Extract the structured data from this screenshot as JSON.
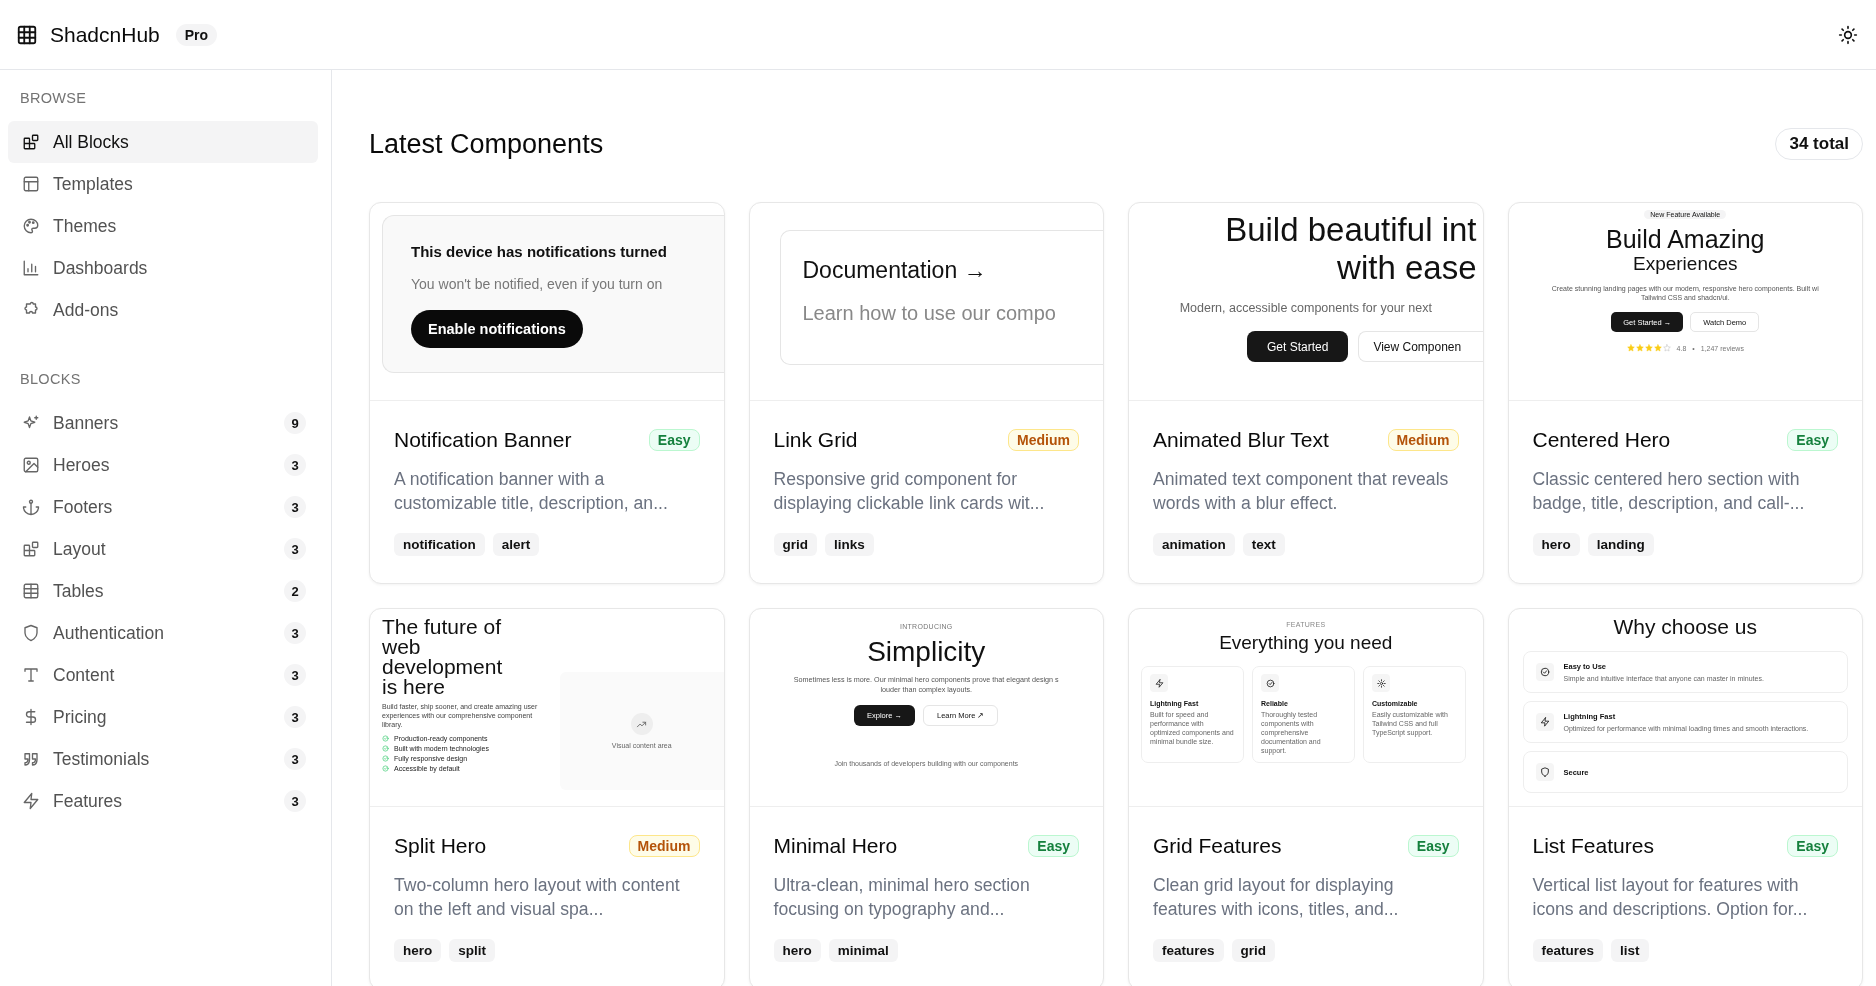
{
  "header": {
    "title": "ShadcnHub",
    "badge": "Pro"
  },
  "sidebar": {
    "sections": [
      {
        "heading": "BROWSE",
        "items": [
          {
            "label": "All Blocks",
            "selected": true
          },
          {
            "label": "Templates",
            "selected": false
          },
          {
            "label": "Themes",
            "selected": false
          },
          {
            "label": "Dashboards",
            "selected": false
          },
          {
            "label": "Add-ons",
            "selected": false
          }
        ]
      },
      {
        "heading": "BLOCKS",
        "items": [
          {
            "label": "Banners",
            "count": "9",
            "selected": false
          },
          {
            "label": "Heroes",
            "count": "3",
            "selected": false
          },
          {
            "label": "Footers",
            "count": "3",
            "selected": false
          },
          {
            "label": "Layout",
            "count": "3",
            "selected": false
          },
          {
            "label": "Tables",
            "count": "2",
            "selected": false
          },
          {
            "label": "Authentication",
            "count": "3",
            "selected": false
          },
          {
            "label": "Content",
            "count": "3",
            "selected": false
          },
          {
            "label": "Pricing",
            "count": "3",
            "selected": false
          },
          {
            "label": "Testimonials",
            "count": "3",
            "selected": false
          },
          {
            "label": "Features",
            "count": "3",
            "selected": false
          }
        ]
      }
    ]
  },
  "main": {
    "title": "Latest Components",
    "total": "34 total",
    "cards": [
      {
        "preview": {
          "kind": "notification",
          "title": "This device has notifications turned",
          "text": "You won't be notified, even if you turn on",
          "button": "Enable notifications"
        },
        "title": "Notification Banner",
        "difficulty": {
          "label": "Easy",
          "kind": "easy"
        },
        "description": "A notification banner with a customizable title, description, an...",
        "tags": [
          "notification",
          "alert"
        ]
      },
      {
        "preview": {
          "kind": "link",
          "title": "Documentation →",
          "text": "Learn how to use our compo"
        },
        "title": "Link Grid",
        "difficulty": {
          "label": "Medium",
          "kind": "medium"
        },
        "description": "Responsive grid component for displaying clickable link cards wit...",
        "tags": [
          "grid",
          "links"
        ]
      },
      {
        "preview": {
          "kind": "blur-text",
          "heading": "Build beautiful int\nwith ease",
          "text": "Modern, accessible components for your next",
          "buttons": [
            "Get Started",
            "View Componen"
          ]
        },
        "title": "Animated Blur Text",
        "difficulty": {
          "label": "Medium",
          "kind": "medium"
        },
        "description": "Animated text component that reveals words with a blur effect.",
        "tags": [
          "animation",
          "text"
        ]
      },
      {
        "preview": {
          "kind": "centered-hero",
          "badge": "New Feature Available",
          "title": "Build Amazing",
          "subtitle": "Experiences",
          "text": "Create stunning landing pages with our modern, responsive hero components. Built wi\nTailwind CSS and shadcn/ui.",
          "buttons": [
            "Get Started →",
            "Watch Demo"
          ],
          "stars": 4,
          "rating": "4.8",
          "separator": "•",
          "reviews": "1,247 reviews"
        },
        "title": "Centered Hero",
        "difficulty": {
          "label": "Easy",
          "kind": "easy"
        },
        "description": "Classic centered hero section with badge, title, description, and call-...",
        "tags": [
          "hero",
          "landing"
        ]
      },
      {
        "preview": {
          "kind": "split-hero",
          "heading": "The future of web development is here",
          "text": "Build faster, ship sooner, and create amazing user experiences with our comprehensive component library.",
          "checklist": [
            "Production-ready components",
            "Built with modern technologies",
            "Fully responsive design",
            "Accessible by default"
          ],
          "visual_label": "Visual content area"
        },
        "title": "Split Hero",
        "difficulty": {
          "label": "Medium",
          "kind": "medium"
        },
        "description": "Two-column hero layout with content on the left and visual spa...",
        "tags": [
          "hero",
          "split"
        ]
      },
      {
        "preview": {
          "kind": "minimal-hero",
          "eyebrow": "INTRODUCING",
          "heading": "Simplicity",
          "text": "Sometimes less is more. Our minimal hero components prove that elegant design s\nlouder than complex layouts.",
          "buttons": [
            "Explore →",
            "Learn More ↗"
          ],
          "footnote": "Join thousands of developers building with our components"
        },
        "title": "Minimal Hero",
        "difficulty": {
          "label": "Easy",
          "kind": "easy"
        },
        "description": "Ultra-clean, minimal hero section focusing on typography and...",
        "tags": [
          "hero",
          "minimal"
        ]
      },
      {
        "preview": {
          "kind": "grid-features",
          "eyebrow": "FEATURES",
          "heading": "Everything you need",
          "features": [
            {
              "title": "Lightning Fast",
              "text": "Built for speed and performance with optimized components and minimal bundle size."
            },
            {
              "title": "Reliable",
              "text": "Thoroughly tested components with comprehensive documentation and support."
            },
            {
              "title": "Customizable",
              "text": "Easily customizable with Tailwind CSS and full TypeScript support."
            }
          ]
        },
        "title": "Grid Features",
        "difficulty": {
          "label": "Easy",
          "kind": "easy"
        },
        "description": "Clean grid layout for displaying features with icons, titles, and...",
        "tags": [
          "features",
          "grid"
        ]
      },
      {
        "preview": {
          "kind": "list-features",
          "heading": "Why choose us",
          "features": [
            {
              "title": "Easy to Use",
              "text": "Simple and intuitive interface that anyone can master in minutes."
            },
            {
              "title": "Lightning Fast",
              "text": "Optimized for performance with minimal loading times and smooth interactions."
            },
            {
              "title": "Secure"
            }
          ]
        },
        "title": "List Features",
        "difficulty": {
          "label": "Easy",
          "kind": "easy"
        },
        "description": "Vertical list layout for features with icons and descriptions. Option for...",
        "tags": [
          "features",
          "list"
        ]
      }
    ]
  }
}
